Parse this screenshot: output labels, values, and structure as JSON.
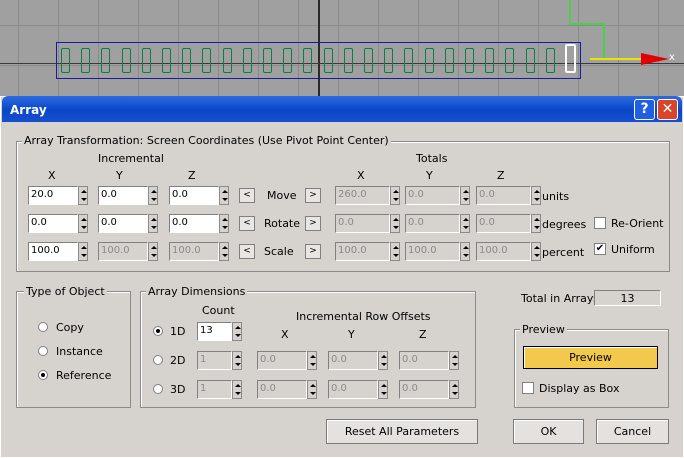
{
  "viewport": {
    "axis_label": "x"
  },
  "dialog": {
    "title": "Array",
    "help_button": "?",
    "close_button": "✕"
  },
  "transformation": {
    "legend": "Array Transformation: Screen Coordinates (Use Pivot Point Center)",
    "incremental_header": "Incremental",
    "totals_header": "Totals",
    "axes": [
      "X",
      "Y",
      "Z"
    ],
    "rows": [
      {
        "label": "Move",
        "incremental": [
          "20.0",
          "0.0",
          "0.0"
        ],
        "totals": [
          "260.0",
          "0.0",
          "0.0"
        ],
        "unit": "units"
      },
      {
        "label": "Rotate",
        "incremental": [
          "0.0",
          "0.0",
          "0.0"
        ],
        "totals": [
          "0.0",
          "0.0",
          "0.0"
        ],
        "unit": "degrees"
      },
      {
        "label": "Scale",
        "incremental": [
          "100.0",
          "100.0",
          "100.0"
        ],
        "totals": [
          "100.0",
          "100.0",
          "100.0"
        ],
        "unit": "percent"
      }
    ],
    "left_arrow": "<",
    "right_arrow": ">",
    "reorient_label": "Re-Orient",
    "reorient_checked": false,
    "uniform_label": "Uniform",
    "uniform_checked": true
  },
  "type_of_object": {
    "legend": "Type of Object",
    "options": [
      "Copy",
      "Instance",
      "Reference"
    ],
    "selected": "Reference"
  },
  "dimensions": {
    "legend": "Array Dimensions",
    "count_header": "Count",
    "offsets_header": "Incremental Row Offsets",
    "axes": [
      "X",
      "Y",
      "Z"
    ],
    "rows": [
      {
        "label": "1D",
        "count": "13",
        "offsets": []
      },
      {
        "label": "2D",
        "count": "1",
        "offsets": [
          "0.0",
          "0.0",
          "0.0"
        ]
      },
      {
        "label": "3D",
        "count": "1",
        "offsets": [
          "0.0",
          "0.0",
          "0.0"
        ]
      }
    ],
    "selected": "1D"
  },
  "total": {
    "label": "Total in Array:",
    "value": "13"
  },
  "preview": {
    "legend": "Preview",
    "button": "Preview",
    "display_as_box_label": "Display as Box",
    "display_as_box_checked": false
  },
  "buttons": {
    "reset": "Reset All Parameters",
    "ok": "OK",
    "cancel": "Cancel"
  },
  "colors": {
    "titlebar": "#0a46c8",
    "preview_button": "#f2c94c",
    "dialog_bg": "#d6d3ce",
    "viewport_bg": "#a0a0a0"
  }
}
